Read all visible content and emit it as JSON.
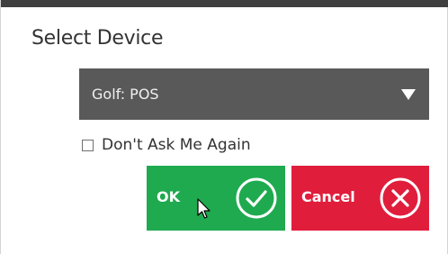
{
  "dialog": {
    "title": "Select Device"
  },
  "device_select": {
    "selected_value": "Golf: POS"
  },
  "dont_ask_again": {
    "label": "Don't Ask Me Again",
    "checked": false
  },
  "buttons": {
    "ok_label": "OK",
    "cancel_label": "Cancel"
  },
  "icons": {
    "ok_icon": "check-circle-icon",
    "cancel_icon": "x-circle-icon",
    "dropdown_icon": "caret-down-icon",
    "cursor": "mouse-pointer-icon"
  },
  "colors": {
    "ok_button": "#1faa4f",
    "cancel_button": "#e01e3c",
    "select_background": "#595959",
    "top_bar": "#3f3f3f"
  }
}
